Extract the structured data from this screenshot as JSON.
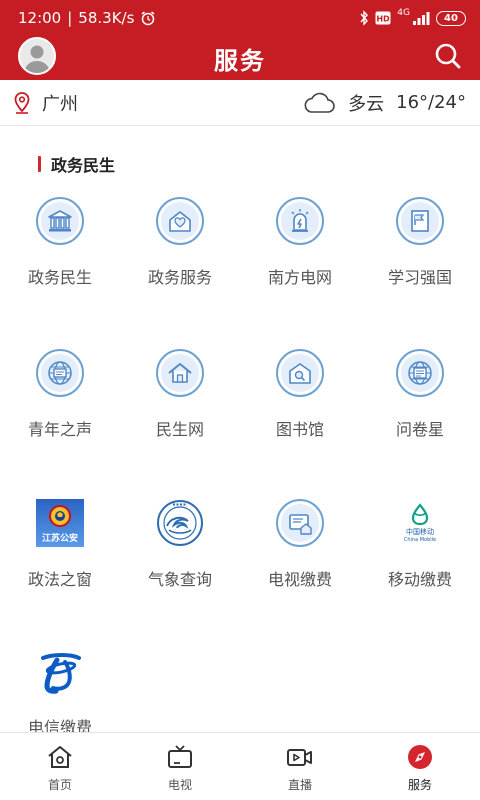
{
  "status_bar": {
    "time": "12:00",
    "speed": "58.3K/s",
    "network": "4G",
    "battery": "40"
  },
  "header": {
    "title": "服务"
  },
  "weather": {
    "city": "广州",
    "condition": "多云",
    "temperature": "16°/24°"
  },
  "section": {
    "title": "政务民生"
  },
  "services": [
    {
      "label": "政务民生",
      "icon": "government-building-icon"
    },
    {
      "label": "政务服务",
      "icon": "heart-house-icon"
    },
    {
      "label": "南方电网",
      "icon": "power-bolt-icon"
    },
    {
      "label": "学习强国",
      "icon": "flag-book-icon"
    },
    {
      "label": "青年之声",
      "icon": "globe-chat-icon"
    },
    {
      "label": "民生网",
      "icon": "house-icon"
    },
    {
      "label": "图书馆",
      "icon": "library-search-icon"
    },
    {
      "label": "问卷星",
      "icon": "globe-survey-icon"
    },
    {
      "label": "政法之窗",
      "icon": "police-emblem-icon"
    },
    {
      "label": "气象查询",
      "icon": "meteorology-logo-icon"
    },
    {
      "label": "电视缴费",
      "icon": "tv-payment-icon"
    },
    {
      "label": "移动缴费",
      "icon": "china-mobile-logo-icon"
    },
    {
      "label": "电信缴费",
      "icon": "china-telecom-logo-icon"
    }
  ],
  "badge_texts": {
    "police_logo": "江苏公安",
    "mobile_logo_cn": "中国移动",
    "mobile_logo_en": "China Mobile"
  },
  "tabbar": [
    {
      "label": "首页",
      "icon": "home-icon",
      "active": false
    },
    {
      "label": "电视",
      "icon": "tv-icon",
      "active": false
    },
    {
      "label": "直播",
      "icon": "live-video-icon",
      "active": false
    },
    {
      "label": "服务",
      "icon": "compass-icon",
      "active": true
    }
  ],
  "colors": {
    "brand_red": "#c61d25",
    "icon_blue": "#6da1d6",
    "icon_fill": "#e3eefa"
  }
}
